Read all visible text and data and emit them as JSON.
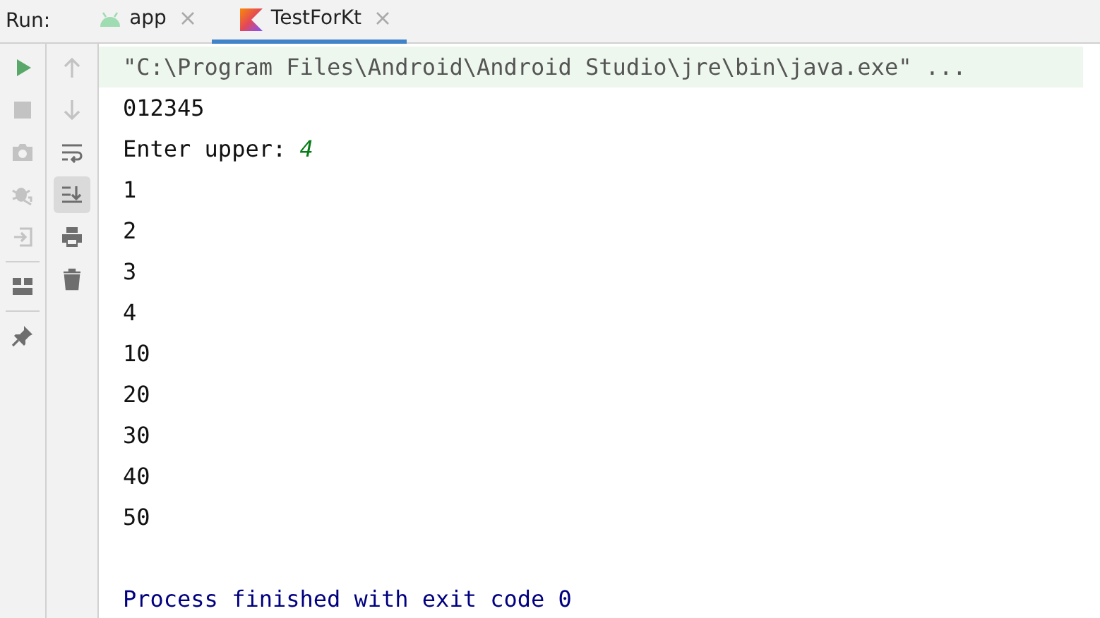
{
  "run_label": "Run:",
  "tabs": [
    {
      "label": "app",
      "kind": "android",
      "selected": false
    },
    {
      "label": "TestForKt",
      "kind": "kotlin",
      "selected": true
    }
  ],
  "toolbar_left": [
    {
      "kind": "run",
      "disabled": false
    },
    {
      "kind": "stop",
      "disabled": true
    },
    {
      "kind": "camera",
      "disabled": true
    },
    {
      "kind": "bug",
      "disabled": true
    },
    {
      "kind": "exit",
      "disabled": true
    },
    {
      "kind": "divider"
    },
    {
      "kind": "layout",
      "disabled": false
    },
    {
      "kind": "divider"
    },
    {
      "kind": "pin",
      "disabled": false
    }
  ],
  "toolbar_right": [
    {
      "kind": "up",
      "disabled": true,
      "selected": false
    },
    {
      "kind": "down",
      "disabled": true,
      "selected": false
    },
    {
      "kind": "wrap",
      "disabled": false,
      "selected": false
    },
    {
      "kind": "scroll",
      "disabled": false,
      "selected": true
    },
    {
      "kind": "print",
      "disabled": false,
      "selected": false
    },
    {
      "kind": "trash",
      "disabled": false,
      "selected": false
    }
  ],
  "console": [
    {
      "kind": "command",
      "text": "\"C:\\Program Files\\Android\\Android Studio\\jre\\bin\\java.exe\" ..."
    },
    {
      "kind": "output",
      "text": "012345"
    },
    {
      "kind": "prompt",
      "text": "Enter upper:",
      "input": "4"
    },
    {
      "kind": "output",
      "text": "1"
    },
    {
      "kind": "output",
      "text": "2"
    },
    {
      "kind": "output",
      "text": "3"
    },
    {
      "kind": "output",
      "text": "4"
    },
    {
      "kind": "output",
      "text": "10"
    },
    {
      "kind": "output",
      "text": "20"
    },
    {
      "kind": "output",
      "text": "30"
    },
    {
      "kind": "output",
      "text": "40"
    },
    {
      "kind": "output",
      "text": "50"
    },
    {
      "kind": "blank"
    },
    {
      "kind": "exit",
      "text": "Process finished with exit code 0"
    }
  ]
}
